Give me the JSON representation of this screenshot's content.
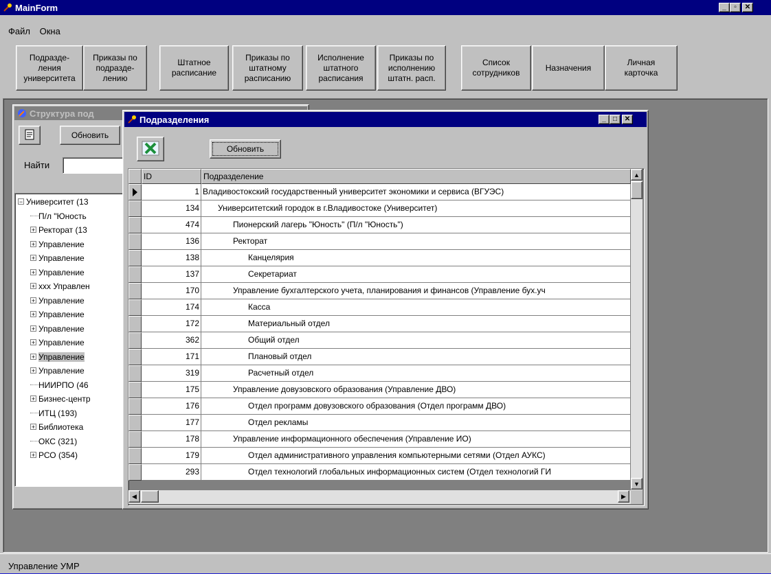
{
  "main": {
    "title": "MainForm",
    "menu": [
      "Файл",
      "Окна"
    ],
    "toolbar": [
      "Подразде-\nления\nуниверситета",
      "Приказы по\nподразде-\nлению",
      "Штатное\nрасписание",
      "Приказы по\nштатному\nрасписанию",
      "Исполнение\nштатного\nрасписания",
      "Приказы по\nисполнению\nштатн. расп.",
      "Список\nсотрудников",
      "Назначения",
      "Личная\nкарточка"
    ],
    "status": "Управление УМР"
  },
  "structure": {
    "title": "Структура под",
    "refresh_label": "Обновить",
    "find_label": "Найти",
    "find_value": "",
    "tree": [
      {
        "text": "Университет (13",
        "expander": "−",
        "level": 0
      },
      {
        "text": "П/л \"Юность",
        "expander": "",
        "level": 1
      },
      {
        "text": "Ректорат (13",
        "expander": "+",
        "level": 1
      },
      {
        "text": "Управление",
        "expander": "+",
        "level": 1
      },
      {
        "text": "Управление",
        "expander": "+",
        "level": 1
      },
      {
        "text": "Управление",
        "expander": "+",
        "level": 1
      },
      {
        "text": "ххх Управлен",
        "expander": "+",
        "level": 1
      },
      {
        "text": "Управление",
        "expander": "+",
        "level": 1
      },
      {
        "text": "Управление",
        "expander": "+",
        "level": 1
      },
      {
        "text": "Управление",
        "expander": "+",
        "level": 1
      },
      {
        "text": "Управление",
        "expander": "+",
        "level": 1
      },
      {
        "text": "Управление",
        "expander": "+",
        "level": 1,
        "selected": true
      },
      {
        "text": "Управление",
        "expander": "+",
        "level": 1
      },
      {
        "text": "НИИРПО (46",
        "expander": "",
        "level": 1
      },
      {
        "text": "Бизнес-центр",
        "expander": "+",
        "level": 1
      },
      {
        "text": "ИТЦ (193)",
        "expander": "",
        "level": 1
      },
      {
        "text": "Библиотека",
        "expander": "+",
        "level": 1
      },
      {
        "text": "ОКС (321)",
        "expander": "",
        "level": 1
      },
      {
        "text": "РСО (354)",
        "expander": "+",
        "level": 1
      }
    ]
  },
  "dialog": {
    "title": "Подразделения",
    "refresh_label": "Обновить",
    "col_id": "ID",
    "col_name": "Подразделение",
    "rows": [
      {
        "id": "1",
        "name": "Владивостокский государственный университет экономики и сервиса (ВГУЭС)",
        "indent": 0,
        "current": true
      },
      {
        "id": "134",
        "name": "Университетский городок в г.Владивостоке (Университет)",
        "indent": 1
      },
      {
        "id": "474",
        "name": "Пионерский лагерь \"Юность\" (П/л \"Юность\")",
        "indent": 2
      },
      {
        "id": "136",
        "name": "Ректорат",
        "indent": 2
      },
      {
        "id": "138",
        "name": "Канцелярия",
        "indent": 3
      },
      {
        "id": "137",
        "name": "Секретариат",
        "indent": 3
      },
      {
        "id": "170",
        "name": "Управление бухгалтерского учета, планирования и финансов (Управление бух.уч",
        "indent": 2
      },
      {
        "id": "174",
        "name": "Касса",
        "indent": 3
      },
      {
        "id": "172",
        "name": "Материальный отдел",
        "indent": 3
      },
      {
        "id": "362",
        "name": "Общий отдел",
        "indent": 3
      },
      {
        "id": "171",
        "name": "Плановый отдел",
        "indent": 3
      },
      {
        "id": "319",
        "name": "Расчетный отдел",
        "indent": 3
      },
      {
        "id": "175",
        "name": "Управление довузовского образования (Управление ДВО)",
        "indent": 2
      },
      {
        "id": "176",
        "name": "Отдел программ довузовского образования (Отдел программ ДВО)",
        "indent": 3
      },
      {
        "id": "177",
        "name": "Отдел рекламы",
        "indent": 3
      },
      {
        "id": "178",
        "name": "Управление информационного обеспечения (Управление ИО)",
        "indent": 2
      },
      {
        "id": "179",
        "name": "Отдел административного управления компьютерными сетями (Отдел АУКС)",
        "indent": 3
      },
      {
        "id": "293",
        "name": "Отдел технологий глобальных информационных систем (Отдел технологий ГИ",
        "indent": 3
      }
    ]
  },
  "colors": {
    "desktop": "#1a1ad0",
    "active_title": "#000080",
    "inactive_title": "#808080",
    "face": "#c0c0c0",
    "excel_icon": "#1b8f3a"
  }
}
